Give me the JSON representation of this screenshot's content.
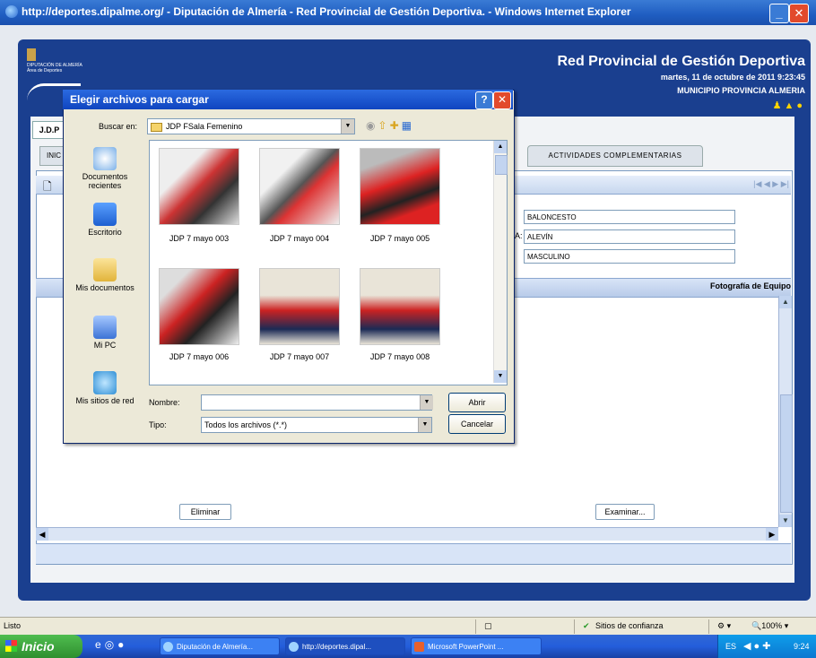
{
  "browser": {
    "title": "http://deportes.dipalme.org/ - Diputación de Almería - Red Provincial de Gestión Deportiva. - Windows Internet Explorer",
    "status_text": "Listo",
    "zone": "Sitios de confianza",
    "zoom": "100%"
  },
  "app": {
    "logo_text": "DIPUTACIÓN DE ALMERÍA",
    "logo_sub": "Área de Deportes",
    "title": "Red Provincial de Gestión Deportiva",
    "date": "martes, 11 de octubre de 2011 9:23:45",
    "municipality": "MUNICIPIO PROVINCIA ALMERIA",
    "tab_jdp": "J.D.P",
    "tab_inicio": "INIC",
    "tab_actividades": "ACTIVIDADES COMPLEMENTARIAS",
    "nav_controls": "|◀ ◀ ▶ ▶|",
    "fields": {
      "deporte": "BALONCESTO",
      "categoria_suffix": "A:",
      "categoria": "ALEVÍN",
      "sexo": "MASCULINO"
    },
    "foto_label": "Fotografía de Equipo",
    "eliminar_label": "Eliminar",
    "examinar_label": "Examinar..."
  },
  "dialog": {
    "title": "Elegir archivos para cargar",
    "look_in_label": "Buscar en:",
    "look_in_value": "JDP FSala Femenino",
    "places": [
      "Documentos recientes",
      "Escritorio",
      "Mis documentos",
      "Mi PC",
      "Mis sitios de red"
    ],
    "files": [
      "JDP 7 mayo 003",
      "JDP 7 mayo 004",
      "JDP 7 mayo 005",
      "JDP 7 mayo 006",
      "JDP 7 mayo 007",
      "JDP 7 mayo 008"
    ],
    "name_label": "Nombre:",
    "name_value": "",
    "type_label": "Tipo:",
    "type_value": "Todos los archivos (*.*)",
    "open_label": "Abrir",
    "cancel_label": "Cancelar"
  },
  "taskbar": {
    "start_label": "Inicio",
    "tasks": [
      "Diputación de Almería...",
      "http://deportes.dipal...",
      "Microsoft PowerPoint ..."
    ],
    "lang": "ES",
    "clock": "9:24"
  }
}
